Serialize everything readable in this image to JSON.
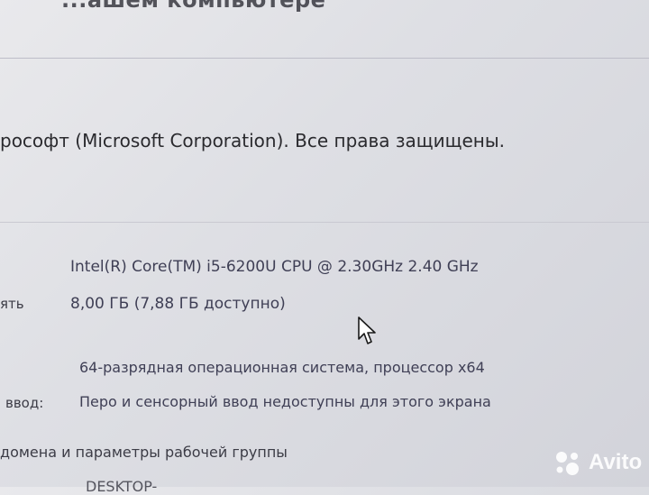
{
  "header": {
    "title_partial": "...ашем компьютере"
  },
  "windows_section": {
    "copyright": "рософт (Microsoft Corporation). Все права защищены."
  },
  "system": {
    "processor_value": "Intel(R) Core(TM) i5-6200U CPU @ 2.30GHz   2.40 GHz",
    "ram_label": "ять",
    "ram_value": "8,00 ГБ (7,88 ГБ доступно)",
    "system_type_value": "64-разрядная операционная система, процессор x64",
    "pen_label": "ввод:",
    "pen_value": "Перо и сенсорный ввод недоступны для этого экрана"
  },
  "domain_section": {
    "title": "домена и параметры рабочей группы",
    "computer_name_partial": "DESKTOP-"
  },
  "watermark": {
    "text": "Avito"
  },
  "icons": {
    "cursor": "mouse-pointer-icon",
    "watermark_logo": "avito-logo-icon"
  }
}
